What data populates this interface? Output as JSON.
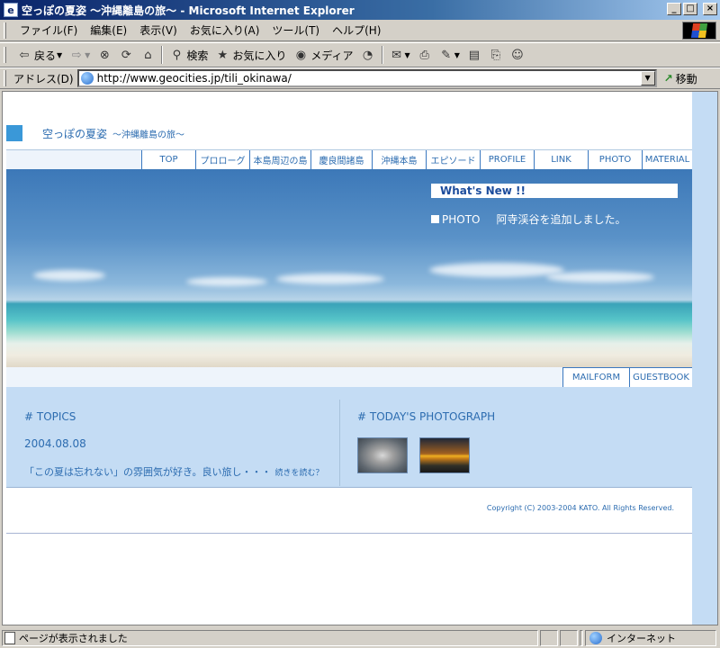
{
  "window": {
    "title": "空っぽの夏姿 〜沖縄離島の旅〜 - Microsoft Internet Explorer",
    "buttons": {
      "minimize": "_",
      "maximize": "□",
      "close": "×"
    }
  },
  "menu": [
    "ファイル(F)",
    "編集(E)",
    "表示(V)",
    "お気に入り(A)",
    "ツール(T)",
    "ヘルプ(H)"
  ],
  "toolbar": {
    "back": "戻る",
    "search": "検索",
    "favorites": "お気に入り",
    "media": "メディア"
  },
  "address": {
    "label": "アドレス(D)",
    "url": "http://www.geocities.jp/tili_okinawa/",
    "go": "移動"
  },
  "site": {
    "title": "空っぽの夏姿",
    "subtitle": "〜沖縄離島の旅〜",
    "nav": [
      "TOP",
      "プロローグ",
      "本島周辺の島",
      "慶良間諸島",
      "沖縄本島",
      "エピソード",
      "PROFILE",
      "LINK",
      "PHOTO",
      "MATERIAL"
    ],
    "whats_new": {
      "heading": "What's New !!",
      "category": "PHOTO",
      "text": "阿寺渓谷を追加しました。"
    },
    "subnav": [
      "MAILFORM",
      "GUESTBOOK"
    ],
    "topics": {
      "heading": "#  TOPICS",
      "date": "2004.08.08",
      "text": "「この夏は忘れない」の雰囲気が好き。良い旅し・・・",
      "more": "続きを読む？"
    },
    "todays_photo": {
      "heading": "#  TODAY'S PHOTOGRAPH"
    },
    "copyright": "Copyright (C) 2003-2004 KATO. All Rights Reserved."
  },
  "status": {
    "text": "ページが表示されました",
    "zone": "インターネット"
  }
}
